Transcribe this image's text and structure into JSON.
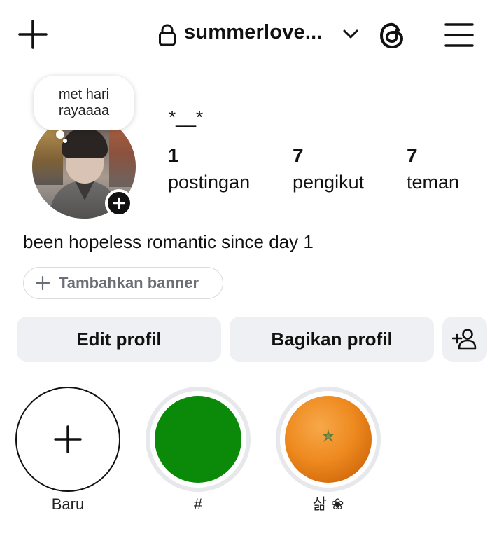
{
  "header": {
    "username": "summerlove...",
    "icons": [
      "plus-icon",
      "lock-icon",
      "chevron-down-icon",
      "threads-icon",
      "menu-icon"
    ]
  },
  "note": {
    "text": "met hari rayaaaa"
  },
  "profile": {
    "display_name": "*__*",
    "stats": [
      {
        "value": "1",
        "label": "postingan"
      },
      {
        "value": "7",
        "label": "pengikut"
      },
      {
        "value": "7",
        "label": "teman"
      }
    ],
    "bio": "been hopeless romantic since day 1"
  },
  "banner": {
    "label": "Tambahkan banner"
  },
  "actions": {
    "edit_label": "Edit profil",
    "share_label": "Bagikan profil"
  },
  "highlights": [
    {
      "label": "Baru"
    },
    {
      "label": "#",
      "color": "#0b8a0a"
    },
    {
      "label": "삶 ❀"
    }
  ],
  "colors": {
    "button_bg": "#eff0f3",
    "ring": "#e6e8ec",
    "text": "#111111",
    "muted": "#6b6f75"
  }
}
